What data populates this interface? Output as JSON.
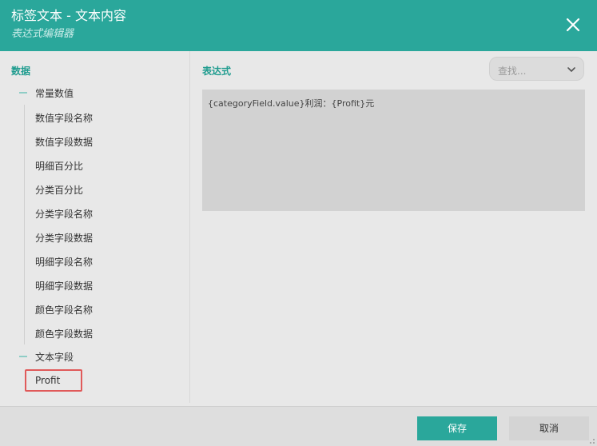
{
  "dialog": {
    "title": "标签文本 - 文本内容",
    "subtitle": "表达式编辑器"
  },
  "left_panel": {
    "section_label": "数据",
    "groups": [
      {
        "label": "常量数值",
        "items": [
          "数值字段名称",
          "数值字段数据",
          "明细百分比",
          "分类百分比",
          "分类字段名称",
          "分类字段数据",
          "明细字段名称",
          "明细字段数据",
          "颜色字段名称",
          "颜色字段数据"
        ]
      },
      {
        "label": "文本字段",
        "items": [
          "Profit"
        ]
      }
    ],
    "selected_item": "Profit"
  },
  "right_panel": {
    "expression_label": "表达式",
    "search": {
      "placeholder": "查找..."
    },
    "expression_value": "{categoryField.value}利润：{Profit}元"
  },
  "footer": {
    "save_label": "保存",
    "cancel_label": "取消"
  },
  "colors": {
    "accent": "#2aa79b",
    "selection_outline": "#e05a5a"
  }
}
